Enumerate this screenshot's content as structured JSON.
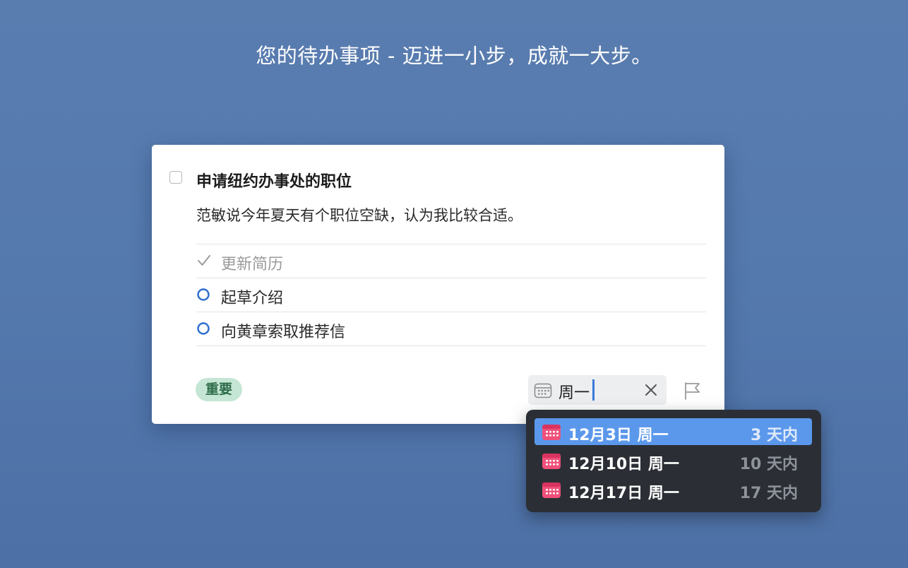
{
  "headline": "您的待办事项 - 迈进一小步，成就一大步。",
  "task": {
    "title": "申请纽约办事处的职位",
    "notes": "范敏说今年夏天有个职位空缺，认为我比较合适。",
    "checklist": [
      {
        "label": "更新简历",
        "done": true
      },
      {
        "label": "起草介绍",
        "done": false
      },
      {
        "label": "向黄章索取推荐信",
        "done": false
      }
    ],
    "tag": "重要",
    "date_input": "周一"
  },
  "date_suggestions": [
    {
      "date": "12月3日 周一",
      "relative": "3 天内",
      "selected": true
    },
    {
      "date": "12月10日 周一",
      "relative": "10 天内",
      "selected": false
    },
    {
      "date": "12月17日 周一",
      "relative": "17 天内",
      "selected": false
    }
  ],
  "colors": {
    "background": "#5479ad",
    "accent": "#5b98ec",
    "tag_bg": "#c5e6d4",
    "tag_text": "#2d6b49",
    "checklist_circle": "#2f6fd0",
    "calendar_icon": "#f0507a"
  }
}
